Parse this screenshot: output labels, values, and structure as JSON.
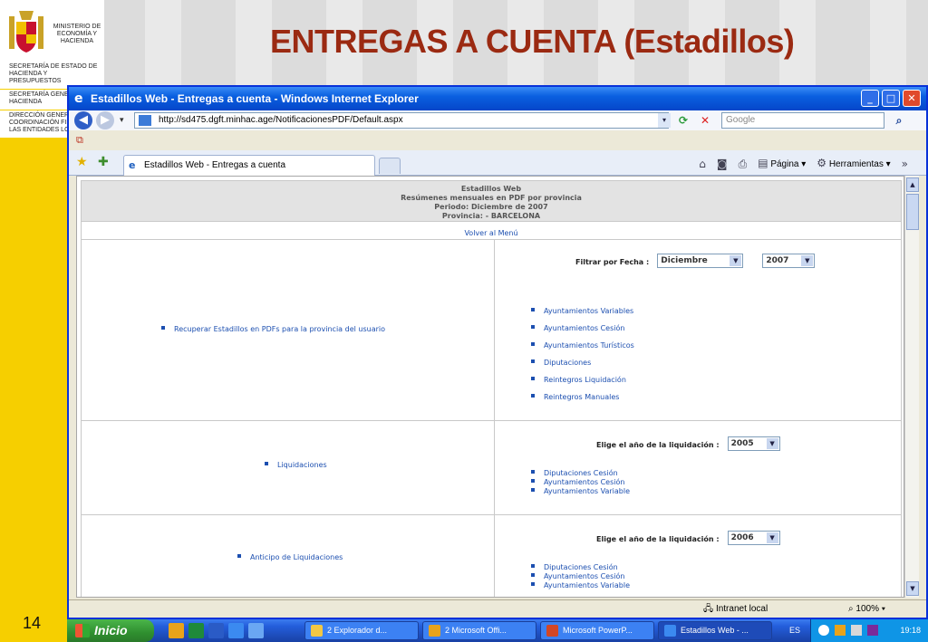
{
  "slide": {
    "ministry": "MINISTERIO DE ECONOMÍA Y HACIENDA",
    "side_lines": [
      "SECRETARÍA DE ESTADO DE HACIENDA Y PRESUPUESTOS",
      "SECRETARÍA GENERAL DE HACIENDA",
      "DIRECCIÓN GENERAL DE COORDINACIÓN FIN... CON LAS ENTIDADES LOCALES"
    ],
    "title": "ENTREGAS A CUENTA (Estadillos)",
    "page_number": "14"
  },
  "browser": {
    "window_title": "Estadillos Web - Entregas a cuenta - Windows Internet Explorer",
    "url": "http://sd475.dgft.minhac.age/NotificacionesPDF/Default.aspx",
    "search_placeholder": "Google",
    "tab_label": "Estadillos Web - Entregas a cuenta",
    "cmd_pagina": "Página",
    "cmd_herramientas": "Herramientas",
    "status_zone": "Intranet local",
    "zoom": "100%"
  },
  "page": {
    "header": {
      "app_name": "Estadillos Web",
      "subtitle": "Resúmenes mensuales en PDF por provincia",
      "periodo": "Periodo: Diciembre de 2007",
      "provincia": "Provincia: - BARCELONA"
    },
    "volver": "Volver al Menú",
    "section1": {
      "left_link": "Recuperar Estadillos en PDFs para la provincia del usuario",
      "filter_label": "Filtrar por Fecha :",
      "month": "Diciembre",
      "year": "2007",
      "links": [
        "Ayuntamientos Variables",
        "Ayuntamientos Cesión",
        "Ayuntamientos Turísticos",
        "Diputaciones",
        "Reintegros Liquidación",
        "Reintegros Manuales"
      ]
    },
    "section2": {
      "left_link": "Liquidaciones",
      "year_label": "Elige el año de la liquidación :",
      "year": "2005",
      "links": [
        "Diputaciones Cesión",
        "Ayuntamientos Cesión",
        "Ayuntamientos Variable"
      ]
    },
    "section3": {
      "left_link": "Anticipo de Liquidaciones",
      "year_label": "Elige el año de la liquidación :",
      "year": "2006",
      "links": [
        "Diputaciones Cesión",
        "Ayuntamientos Cesión",
        "Ayuntamientos Variable"
      ]
    }
  },
  "taskbar": {
    "start": "Inicio",
    "tasks": [
      "2 Explorador d...",
      "2 Microsoft Offi...",
      "Microsoft PowerP...",
      "Estadillos Web - ..."
    ],
    "lang": "ES",
    "clock": "19:18"
  },
  "colors": {
    "title_red": "#9b2a12",
    "side_yellow": "#f6cf00",
    "link_blue": "#1c4fb0",
    "xp_blue": "#245edb",
    "start_green": "#2f8f2f"
  }
}
